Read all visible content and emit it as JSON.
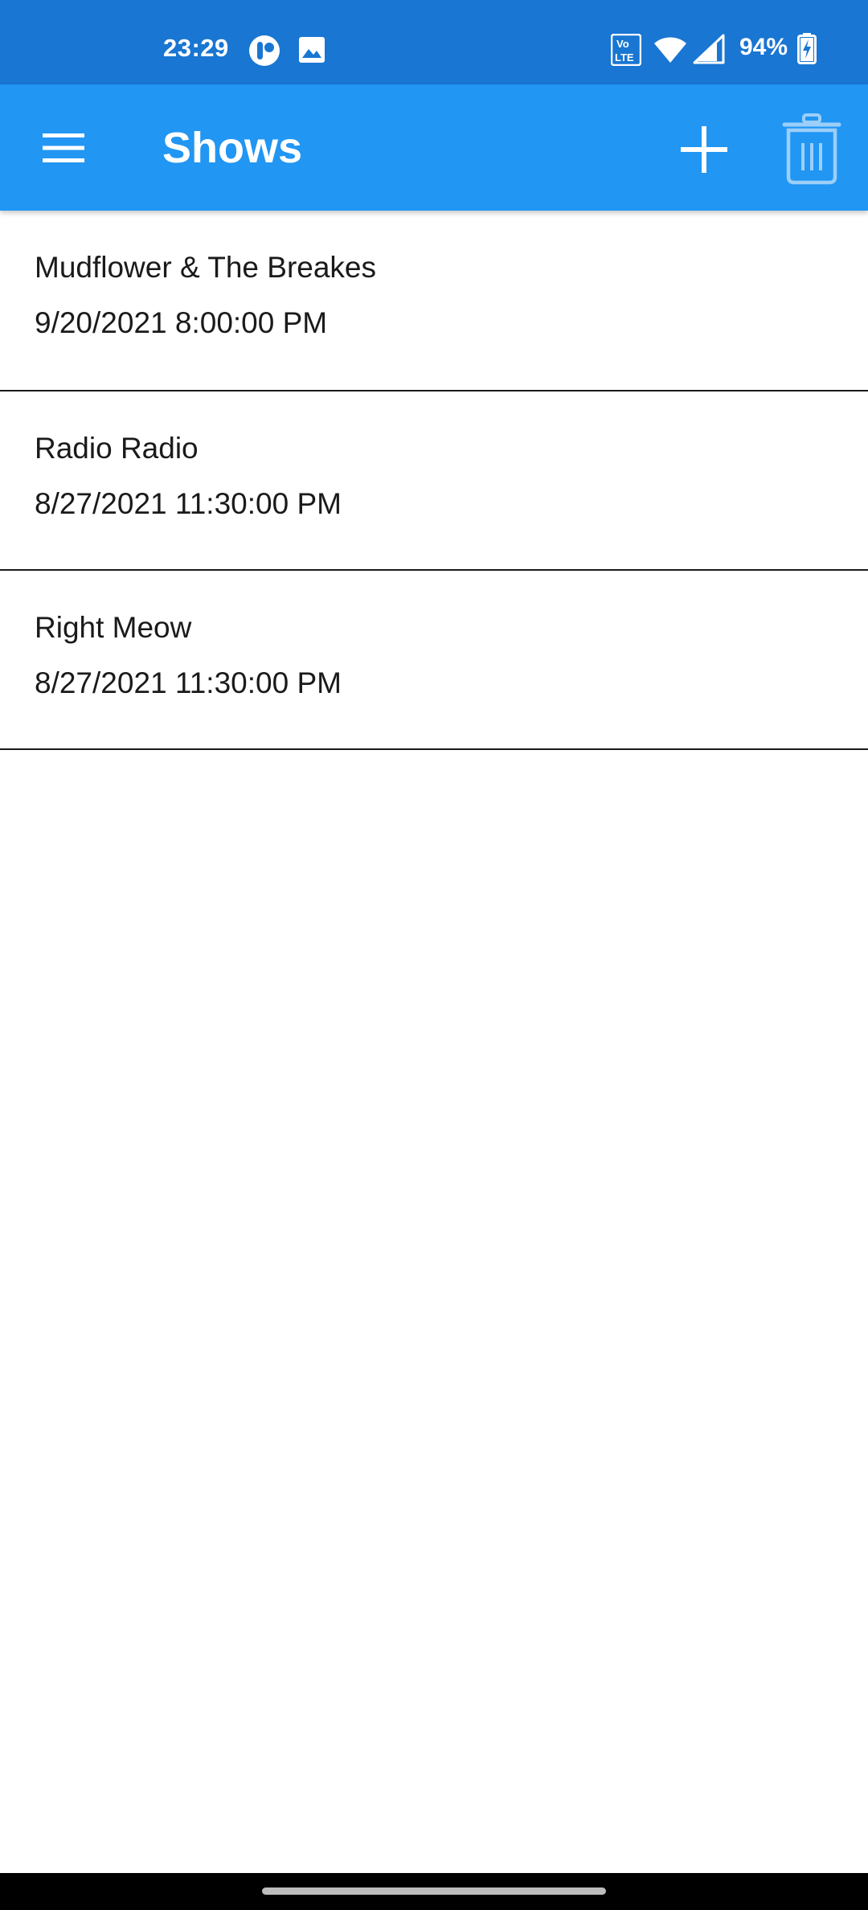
{
  "status_bar": {
    "time": "23:29",
    "battery_percent": "94%",
    "volte_label_top": "Vo",
    "volte_label_bottom": "LTE",
    "icons": [
      "app-notification-icon",
      "gallery-icon",
      "volte-icon",
      "wifi-icon",
      "cell-signal-icon",
      "battery-charging-icon"
    ]
  },
  "app_bar": {
    "title": "Shows",
    "menu_icon": "hamburger-menu-icon",
    "add_icon": "plus-icon",
    "delete_icon": "trash-icon",
    "color": "#2196F3"
  },
  "shows": [
    {
      "name": "Mudflower & The Breakes",
      "datetime": "9/20/2021 8:00:00 PM"
    },
    {
      "name": "Radio Radio",
      "datetime": "8/27/2021 11:30:00 PM"
    },
    {
      "name": "Right Meow",
      "datetime": "8/27/2021 11:30:00 PM"
    }
  ],
  "colors": {
    "status_bar": "#1976D2",
    "app_bar": "#2196F3",
    "background": "#FFFFFF",
    "divider": "#1A1A1A"
  }
}
